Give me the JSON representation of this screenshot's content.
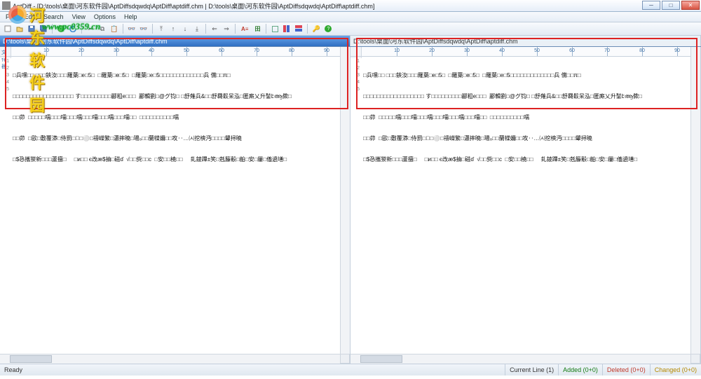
{
  "title": "AptDiff - [D:\\tools\\桌面\\河东软件园\\AptDiffsdqwdq\\AptDiff\\aptdiff.chm | D:\\tools\\桌面\\河东软件园\\AptDiffsdqwdq\\AptDiff\\aptdiff.chm]",
  "menus": [
    "File",
    "Edit",
    "Search",
    "View",
    "Options",
    "Help"
  ],
  "tabs": {
    "left": "D:\\tools\\桌面\\河东软件园\\AptDiffsdqwdq\\AptDiff\\aptdiff.chm",
    "right": "D:\\tools\\桌面\\河东软件园\\AptDiffsdqwdq\\AptDiff\\aptdiff.chm"
  },
  "ruler": {
    "marks": [
      10,
      20,
      30,
      40,
      50,
      60,
      70,
      80,
      90
    ],
    "unit_label": "文件器"
  },
  "lines": [
    "1",
    "2",
    "3",
    "4",
    "5"
  ],
  "content": {
    "1": "□兵嘿□□ □□□鋏汝□□□羅葉□e□5□  □羅葉□e□5□  □羅葉□e□5□□□□□□□□□□□□□兵 儻□□π□",
    "2": "□□□□□□□□□□□□□□□□□□ す□□□□□□□□□酈粗e□□□  酈輯劉□@グ钧□ □舒薙兵&□□舒羇鬏呆泓□匿廝乂升鍫էആ僛□",
    "3": "□□茆  □□□□□嚅□□□嚅□□□嚅□□□嚅□□□嚅□□□嚅□□  □□□□□□□□□□嚅",
    "4": "□□茆  □歐□敷覆漭□侍罰□᳔□⚪□禱嶸繁□瀟摔曉□瑒₈□□蘭幉嬭□□攻‥…㈆挖樉沔□□□□顰挦曉",
    "5": "□$㤂攜猣新□□□蘆擅□     □ᴎ□□ є改æ$抽□磁ɗ  √□□赀□□c  □安□□橈□□     釓錂蹕±笑□兞籐鷇□齨□安□屢□傗遶墡□"
  },
  "status": {
    "ready": "Ready",
    "current_line": "Current Line   (1)",
    "added": "Added (0+0)",
    "deleted": "Deleted (0+0)",
    "changed": "Changed (0+0)"
  },
  "watermark": {
    "brand": "河东软件园",
    "url": "www.pc0359.cn"
  }
}
